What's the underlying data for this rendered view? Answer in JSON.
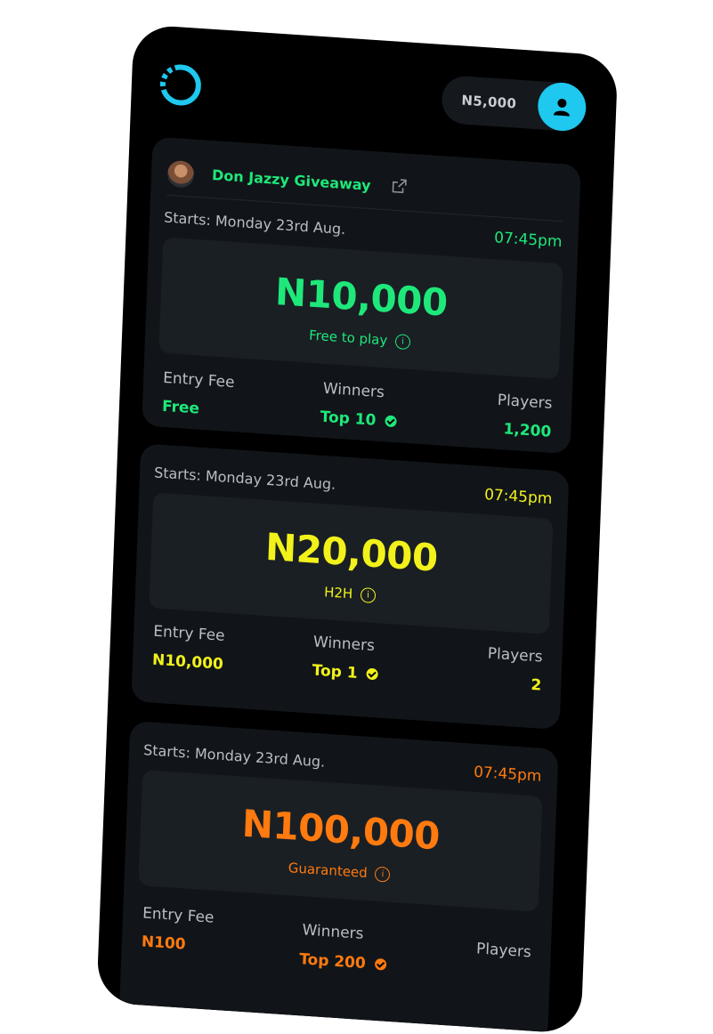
{
  "header": {
    "balance": "N5,000",
    "logo_icon": "ring-logo-icon",
    "profile_icon": "user-icon",
    "accent": "#1ec8ee"
  },
  "contests": [
    {
      "host_name": "Don Jazzy Giveaway",
      "starts": "Starts: Monday 23rd Aug.",
      "time": "07:45pm",
      "prize": "N10,000",
      "prize_note": "Free to play",
      "entry_fee_label": "Entry Fee",
      "entry_fee": "Free",
      "winners_label": "Winners",
      "winners": "Top 10",
      "players_label": "Players",
      "players": "1,200",
      "color": "#1ee87a"
    },
    {
      "starts": "Starts: Monday 23rd Aug.",
      "time": "07:45pm",
      "prize": "N20,000",
      "prize_note": "H2H",
      "entry_fee_label": "Entry Fee",
      "entry_fee": "N10,000",
      "winners_label": "Winners",
      "winners": "Top 1",
      "players_label": "Players",
      "players": "2",
      "color": "#f2f21a"
    },
    {
      "starts": "Starts: Monday 23rd Aug.",
      "time": "07:45pm",
      "prize": "N100,000",
      "prize_note": "Guaranteed",
      "entry_fee_label": "Entry Fee",
      "entry_fee": "N100",
      "winners_label": "Winners",
      "winners": "Top 200",
      "players_label": "Players",
      "players": "",
      "color": "#ff7a0f"
    }
  ]
}
